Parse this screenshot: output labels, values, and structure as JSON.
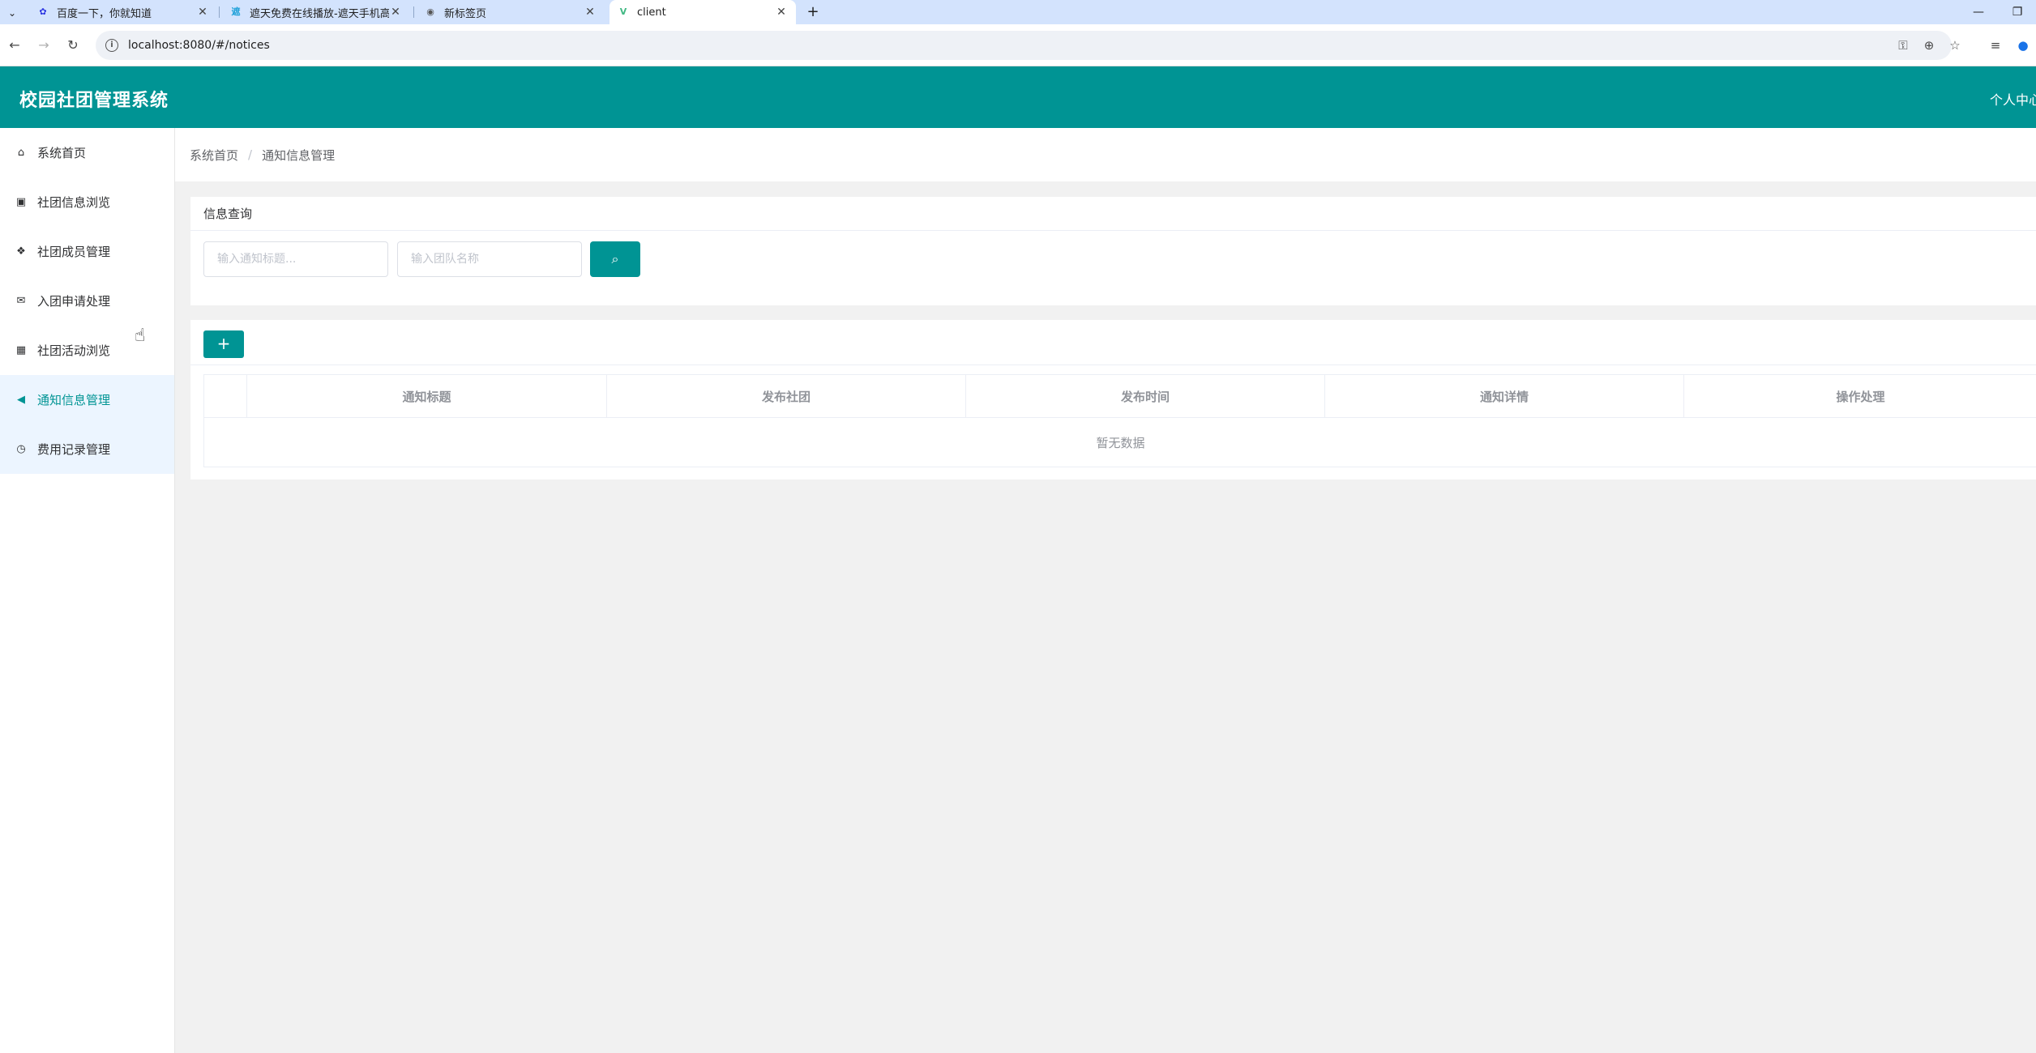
{
  "browser": {
    "tabs": [
      {
        "title": "百度一下，你就知道",
        "icon": "baidu-paw-icon"
      },
      {
        "title": "遮天免费在线播放-遮天手机高清",
        "icon": "video-site-icon"
      },
      {
        "title": "新标签页",
        "icon": "chrome-icon"
      },
      {
        "title": "client",
        "icon": "vue-icon",
        "active": true
      }
    ],
    "url": "localhost:8080/#/notices"
  },
  "header": {
    "title": "校园社团管理系统",
    "user_center": "个人中心"
  },
  "sidebar": {
    "items": [
      {
        "label": "系统首页",
        "icon": "home-icon"
      },
      {
        "label": "社团信息浏览",
        "icon": "train-icon"
      },
      {
        "label": "社团成员管理",
        "icon": "cubes-icon"
      },
      {
        "label": "入团申请处理",
        "icon": "envelope-open-icon"
      },
      {
        "label": "社团活动浏览",
        "icon": "calculator-icon"
      },
      {
        "label": "通知信息管理",
        "icon": "bullhorn-icon",
        "active": true
      },
      {
        "label": "费用记录管理",
        "icon": "clock-icon"
      }
    ]
  },
  "breadcrumb": {
    "home": "系统首页",
    "current": "通知信息管理"
  },
  "search": {
    "title": "信息查询",
    "notice_title_placeholder": "输入通知标题...",
    "team_name_placeholder": "输入团队名称"
  },
  "table": {
    "add_label": "+",
    "columns": [
      "通知标题",
      "发布社团",
      "发布时间",
      "通知详情",
      "操作处理"
    ],
    "empty_text": "暂无数据"
  },
  "colors": {
    "primary": "#009494",
    "active_menu_bg": "#ecf5ff"
  }
}
